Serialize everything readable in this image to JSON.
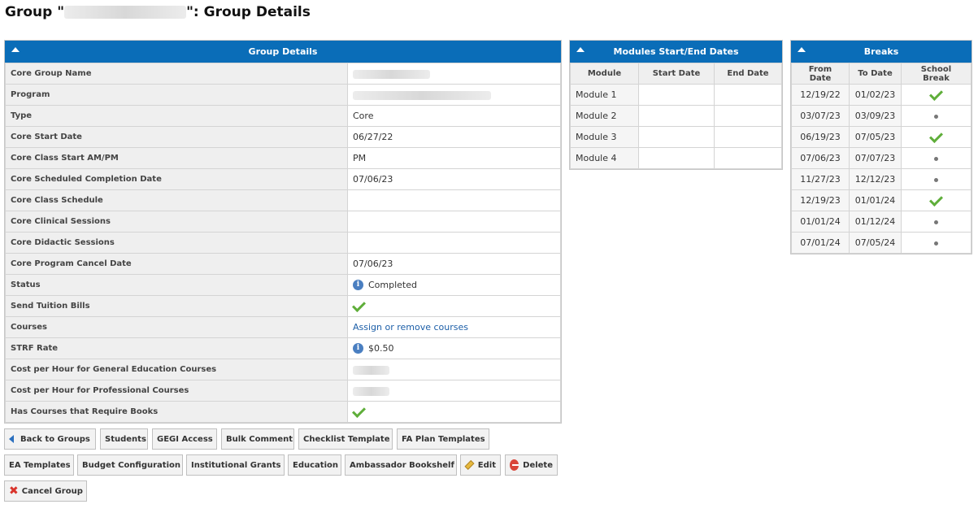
{
  "page": {
    "title_prefix": "Group \"",
    "title_suffix": "\": Group Details"
  },
  "details": {
    "header": "Group Details",
    "rows": [
      {
        "label": "Core Group Name",
        "value": "",
        "kind": "blurred"
      },
      {
        "label": "Program",
        "value": "",
        "kind": "blurred"
      },
      {
        "label": "Type",
        "value": "Core",
        "kind": "text"
      },
      {
        "label": "Core Start Date",
        "value": "06/27/22",
        "kind": "text"
      },
      {
        "label": "Core Class Start AM/PM",
        "value": "PM",
        "kind": "text"
      },
      {
        "label": "Core Scheduled Completion Date",
        "value": "07/06/23",
        "kind": "text"
      },
      {
        "label": "Core Class Schedule",
        "value": "",
        "kind": "text"
      },
      {
        "label": "Core Clinical Sessions",
        "value": "",
        "kind": "text"
      },
      {
        "label": "Core Didactic Sessions",
        "value": "",
        "kind": "text"
      },
      {
        "label": "Core Program Cancel Date",
        "value": "07/06/23",
        "kind": "text"
      },
      {
        "label": "Status",
        "value": "Completed",
        "kind": "info"
      },
      {
        "label": "Send Tuition Bills",
        "value": "",
        "kind": "check"
      },
      {
        "label": "Courses",
        "value": "Assign or remove courses",
        "kind": "link"
      },
      {
        "label": "STRF Rate",
        "value": "$0.50",
        "kind": "info"
      },
      {
        "label": "Cost per Hour for General Education Courses",
        "value": "",
        "kind": "blurred"
      },
      {
        "label": "Cost per Hour for Professional Courses",
        "value": "",
        "kind": "blurred"
      },
      {
        "label": "Has Courses that Require Books",
        "value": "",
        "kind": "check"
      }
    ]
  },
  "modules": {
    "header": "Modules Start/End Dates",
    "columns": [
      "Module",
      "Start Date",
      "End Date"
    ],
    "rows": [
      {
        "module": "Module 1",
        "start": "",
        "end": ""
      },
      {
        "module": "Module 2",
        "start": "",
        "end": ""
      },
      {
        "module": "Module 3",
        "start": "",
        "end": ""
      },
      {
        "module": "Module 4",
        "start": "",
        "end": ""
      }
    ]
  },
  "breaks": {
    "header": "Breaks",
    "columns": [
      "From Date",
      "To Date",
      "School Break"
    ],
    "rows": [
      {
        "from": "12/19/22",
        "to": "01/02/23",
        "school_break": true
      },
      {
        "from": "03/07/23",
        "to": "03/09/23",
        "school_break": false
      },
      {
        "from": "06/19/23",
        "to": "07/05/23",
        "school_break": true
      },
      {
        "from": "07/06/23",
        "to": "07/07/23",
        "school_break": false
      },
      {
        "from": "11/27/23",
        "to": "12/12/23",
        "school_break": false
      },
      {
        "from": "12/19/23",
        "to": "01/01/24",
        "school_break": true
      },
      {
        "from": "01/01/24",
        "to": "01/12/24",
        "school_break": false
      },
      {
        "from": "07/01/24",
        "to": "07/05/24",
        "school_break": false
      }
    ]
  },
  "buttons": {
    "back": "Back to Groups",
    "students": "Students",
    "gegi": "GEGI Access",
    "bulk_comment": "Bulk Comment",
    "checklist": "Checklist Template",
    "fa_plan": "FA Plan Templates",
    "ea_templates": "EA Templates",
    "budget": "Budget Configuration",
    "grants": "Institutional Grants",
    "education": "Education",
    "bookshelf": "Ambassador Bookshelf",
    "edit": "Edit",
    "delete": "Delete",
    "cancel": "Cancel Group"
  },
  "colors": {
    "header_blue": "#0a6db8",
    "check_green": "#5fae3a",
    "link_blue": "#1d5fa8"
  }
}
